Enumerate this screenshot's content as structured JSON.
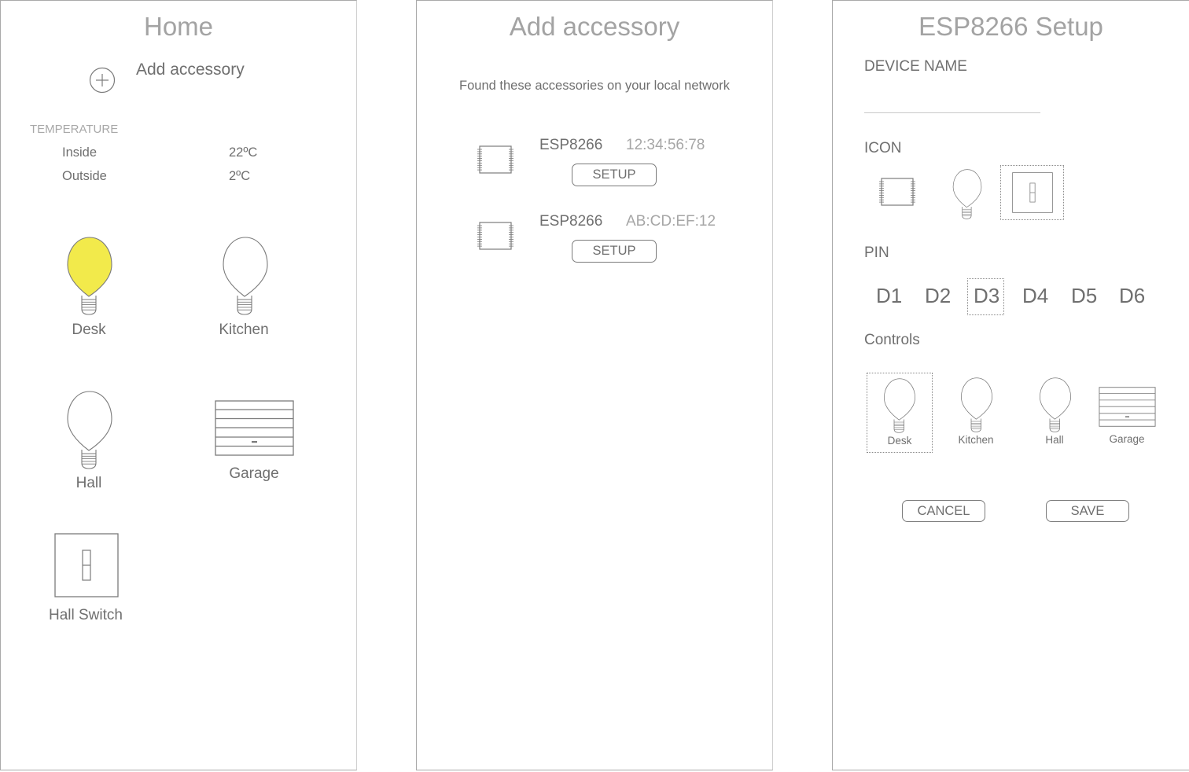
{
  "home": {
    "title": "Home",
    "add_accessory_label": "Add accessory",
    "temperature": {
      "section_label": "TEMPERATURE",
      "rows": [
        {
          "label": "Inside",
          "value": "22ºC"
        },
        {
          "label": "Outside",
          "value": "2ºC"
        }
      ]
    },
    "accessories": [
      {
        "name": "Desk",
        "icon": "lightbulb-icon",
        "state": "on",
        "color": "#f2ea4b"
      },
      {
        "name": "Kitchen",
        "icon": "lightbulb-icon",
        "state": "off"
      },
      {
        "name": "Hall",
        "icon": "lightbulb-icon",
        "state": "off"
      },
      {
        "name": "Garage",
        "icon": "garage-door-icon"
      },
      {
        "name": "Hall Switch",
        "icon": "light-switch-icon"
      }
    ]
  },
  "add_accessory": {
    "title": "Add accessory",
    "subtitle": "Found these accessories on your local network",
    "devices": [
      {
        "name": "ESP8266",
        "mac": "12:34:56:78",
        "button_label": "SETUP",
        "icon": "chip-icon"
      },
      {
        "name": "ESP8266",
        "mac": "AB:CD:EF:12",
        "button_label": "SETUP",
        "icon": "chip-icon"
      }
    ]
  },
  "setup": {
    "title": "ESP8266 Setup",
    "device_name_label": "DEVICE NAME",
    "device_name_value": "",
    "icon_label": "ICON",
    "icons": [
      {
        "name": "chip-icon",
        "selected": false
      },
      {
        "name": "lightbulb-icon",
        "selected": false
      },
      {
        "name": "light-switch-icon",
        "selected": true
      }
    ],
    "pin_label": "PIN",
    "pins": [
      "D1",
      "D2",
      "D3",
      "D4",
      "D5",
      "D6"
    ],
    "selected_pin": "D3",
    "controls_label": "Controls",
    "controls": [
      {
        "name": "Desk",
        "icon": "lightbulb-icon",
        "selected": true
      },
      {
        "name": "Kitchen",
        "icon": "lightbulb-icon",
        "selected": false
      },
      {
        "name": "Hall",
        "icon": "lightbulb-icon",
        "selected": false
      },
      {
        "name": "Garage",
        "icon": "garage-door-icon",
        "selected": false
      }
    ],
    "cancel_label": "CANCEL",
    "save_label": "SAVE"
  },
  "colors": {
    "bulb_on": "#f2ea4b",
    "stroke": "#7b7b7b",
    "title_text": "#a3a3a3"
  }
}
